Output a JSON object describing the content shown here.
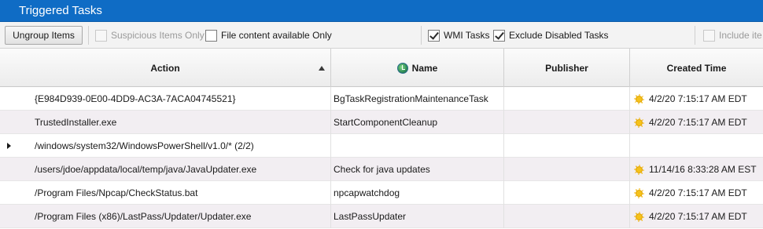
{
  "window": {
    "title": "Triggered Tasks"
  },
  "toolbar": {
    "ungroup_label": "Ungroup Items",
    "checkboxes": [
      {
        "label": "Suspicious Items Only",
        "checked": false,
        "disabled": true
      },
      {
        "label": "File content available Only",
        "checked": false,
        "disabled": false
      },
      {
        "label": "WMI Tasks",
        "checked": true,
        "disabled": false
      },
      {
        "label": "Exclude Disabled Tasks",
        "checked": true,
        "disabled": false
      },
      {
        "label": "Include ite",
        "checked": false,
        "disabled": true
      }
    ]
  },
  "table": {
    "columns": {
      "action": "Action",
      "name": "Name",
      "publisher": "Publisher",
      "created": "Created Time"
    },
    "sort": {
      "column": "action",
      "direction": "ascending"
    },
    "rows": [
      {
        "action": "{E984D939-0E00-4DD9-AC3A-7ACA04745521}",
        "name": "BgTaskRegistrationMaintenanceTask",
        "publisher": "",
        "created": "4/2/20 7:15:17 AM EDT",
        "expandable": false
      },
      {
        "action": "TrustedInstaller.exe",
        "name": "StartComponentCleanup",
        "publisher": "",
        "created": "4/2/20 7:15:17 AM EDT",
        "expandable": false
      },
      {
        "action": "/windows/system32/WindowsPowerShell/v1.0/* (2/2)",
        "name": "",
        "publisher": "",
        "created": "",
        "expandable": true
      },
      {
        "action": "/users/jdoe/appdata/local/temp/java/JavaUpdater.exe",
        "name": "Check for java updates",
        "publisher": "",
        "created": "11/14/16 8:33:28 AM EST",
        "expandable": false
      },
      {
        "action": "/Program Files/Npcap/CheckStatus.bat",
        "name": "npcapwatchdog",
        "publisher": "",
        "created": "4/2/20 7:15:17 AM EDT",
        "expandable": false
      },
      {
        "action": "/Program Files (x86)/LastPass/Updater/Updater.exe",
        "name": "LastPassUpdater",
        "publisher": "",
        "created": "4/2/20 7:15:17 AM EDT",
        "expandable": false
      }
    ]
  },
  "icons": {
    "name_column": "task-status-icon",
    "created_time": "sun-icon",
    "expander": "expand-arrow-icon"
  }
}
